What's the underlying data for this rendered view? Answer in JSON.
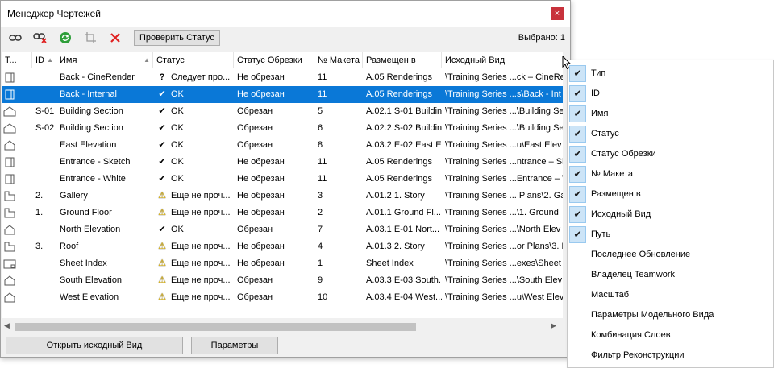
{
  "window": {
    "title": "Менеджер Чертежей",
    "close_label": "×"
  },
  "toolbar": {
    "icons": [
      "link-drawing-icon",
      "unlink-drawing-icon",
      "refresh-icon",
      "crop-icon",
      "delete-icon"
    ],
    "check_status_label": "Проверить Статус",
    "selected_text": "Выбрано: 1"
  },
  "grid": {
    "columns": [
      {
        "label": "Т..."
      },
      {
        "label": "ID"
      },
      {
        "label": "Имя"
      },
      {
        "label": "Статус"
      },
      {
        "label": "Статус Обрезки"
      },
      {
        "label": "№ Макета"
      },
      {
        "label": "Размещен в"
      },
      {
        "label": "Исходный Вид"
      }
    ],
    "rows": [
      {
        "type_icon": "section-view-icon",
        "id": "",
        "name": "Back - CineRender",
        "status_icon": "?",
        "status": "Следует про...",
        "crop": "Не обрезан",
        "layout": "11",
        "placed": "A.05 Renderings",
        "source": "\\Training Series ...ck – CineRe",
        "selected": false
      },
      {
        "type_icon": "section-view-icon",
        "id": "",
        "name": "Back - Internal",
        "status_icon": "✔",
        "status": "OK",
        "crop": "Не обрезан",
        "layout": "11",
        "placed": "A.05 Renderings",
        "source": "\\Training Series ...s\\Back - Int",
        "selected": true
      },
      {
        "type_icon": "elevation-icon",
        "id": "S-01",
        "name": "Building Section",
        "status_icon": "✔",
        "status": "OK",
        "crop": "Обрезан",
        "layout": "5",
        "placed": "A.02.1 S-01 Buildin...",
        "source": "\\Training Series ...\\Building Se",
        "selected": false
      },
      {
        "type_icon": "elevation-icon",
        "id": "S-02",
        "name": "Building Section",
        "status_icon": "✔",
        "status": "OK",
        "crop": "Обрезан",
        "layout": "6",
        "placed": "A.02.2 S-02 Buildin...",
        "source": "\\Training Series ...\\Building Se",
        "selected": false
      },
      {
        "type_icon": "house-icon",
        "id": "",
        "name": "East Elevation",
        "status_icon": "✔",
        "status": "OK",
        "crop": "Обрезан",
        "layout": "8",
        "placed": "A.03.2 E-02 East El...",
        "source": "\\Training Series ...u\\East Elev",
        "selected": false
      },
      {
        "type_icon": "section-view-icon",
        "id": "",
        "name": "Entrance - Sketch",
        "status_icon": "✔",
        "status": "OK",
        "crop": "Не обрезан",
        "layout": "11",
        "placed": "A.05 Renderings",
        "source": "\\Training Series ...ntrance – Sk",
        "selected": false
      },
      {
        "type_icon": "section-view-icon",
        "id": "",
        "name": "Entrance - White",
        "status_icon": "✔",
        "status": "OK",
        "crop": "Не обрезан",
        "layout": "11",
        "placed": "A.05 Renderings",
        "source": "\\Training Series ...Entrance – W",
        "selected": false
      },
      {
        "type_icon": "floorplan-icon",
        "id": "2.",
        "name": "Gallery",
        "status_icon": "⚠",
        "status": "Еще не проч...",
        "crop": "Не обрезан",
        "layout": "3",
        "placed": "A.01.2 1. Story",
        "source": "\\Training Series ... Plans\\2. Ga",
        "selected": false
      },
      {
        "type_icon": "floorplan-icon",
        "id": "1.",
        "name": "Ground Floor",
        "status_icon": "⚠",
        "status": "Еще не проч...",
        "crop": "Не обрезан",
        "layout": "2",
        "placed": "A.01.1 Ground Fl...",
        "source": "\\Training Series ...\\1. Ground",
        "selected": false
      },
      {
        "type_icon": "house-icon",
        "id": "",
        "name": "North Elevation",
        "status_icon": "✔",
        "status": "OK",
        "crop": "Обрезан",
        "layout": "7",
        "placed": "A.03.1 E-01 Nort...",
        "source": "\\Training Series ...\\North Elev",
        "selected": false
      },
      {
        "type_icon": "floorplan-icon",
        "id": "3.",
        "name": "Roof",
        "status_icon": "⚠",
        "status": "Еще не проч...",
        "crop": "Не обрезан",
        "layout": "4",
        "placed": "A.01.3 2. Story",
        "source": "\\Training Series ...or Plans\\3. R",
        "selected": false
      },
      {
        "type_icon": "sheet-icon",
        "id": "",
        "name": "Sheet Index",
        "status_icon": "⚠",
        "status": "Еще не проч...",
        "crop": "Не обрезан",
        "layout": "1",
        "placed": "Sheet Index",
        "source": "\\Training Series ...exes\\Sheet I",
        "selected": false
      },
      {
        "type_icon": "house-icon",
        "id": "",
        "name": "South Elevation",
        "status_icon": "⚠",
        "status": "Еще не проч...",
        "crop": "Обрезан",
        "layout": "9",
        "placed": "A.03.3 E-03 South...",
        "source": "\\Training Series ...\\South Elev",
        "selected": false
      },
      {
        "type_icon": "house-icon",
        "id": "",
        "name": "West Elevation",
        "status_icon": "⚠",
        "status": "Еще не проч...",
        "crop": "Обрезан",
        "layout": "10",
        "placed": "A.03.4 E-04 West...",
        "source": "\\Training Series ...u\\West Elev",
        "selected": false
      }
    ]
  },
  "buttons": {
    "open_source": "Открыть исходный Вид",
    "settings": "Параметры"
  },
  "column_menu": {
    "items": [
      {
        "label": "Тип",
        "checked": true
      },
      {
        "label": "ID",
        "checked": true
      },
      {
        "label": "Имя",
        "checked": true
      },
      {
        "label": "Статус",
        "checked": true
      },
      {
        "label": "Статус Обрезки",
        "checked": true
      },
      {
        "label": "№ Макета",
        "checked": true
      },
      {
        "label": "Размещен в",
        "checked": true
      },
      {
        "label": "Исходный Вид",
        "checked": true
      },
      {
        "label": "Путь",
        "checked": true
      },
      {
        "label": "Последнее Обновление",
        "checked": false
      },
      {
        "label": "Владелец Teamwork",
        "checked": false
      },
      {
        "label": "Масштаб",
        "checked": false
      },
      {
        "label": "Параметры Модельного Вида",
        "checked": false
      },
      {
        "label": "Комбинация Слоев",
        "checked": false
      },
      {
        "label": "Фильтр Реконструкции",
        "checked": false
      }
    ]
  },
  "colors": {
    "selection": "#0a78d7",
    "ok": "#1a1a1a",
    "warning": "#f2c200",
    "delete": "#e02020",
    "refresh": "#2e9e3a"
  }
}
